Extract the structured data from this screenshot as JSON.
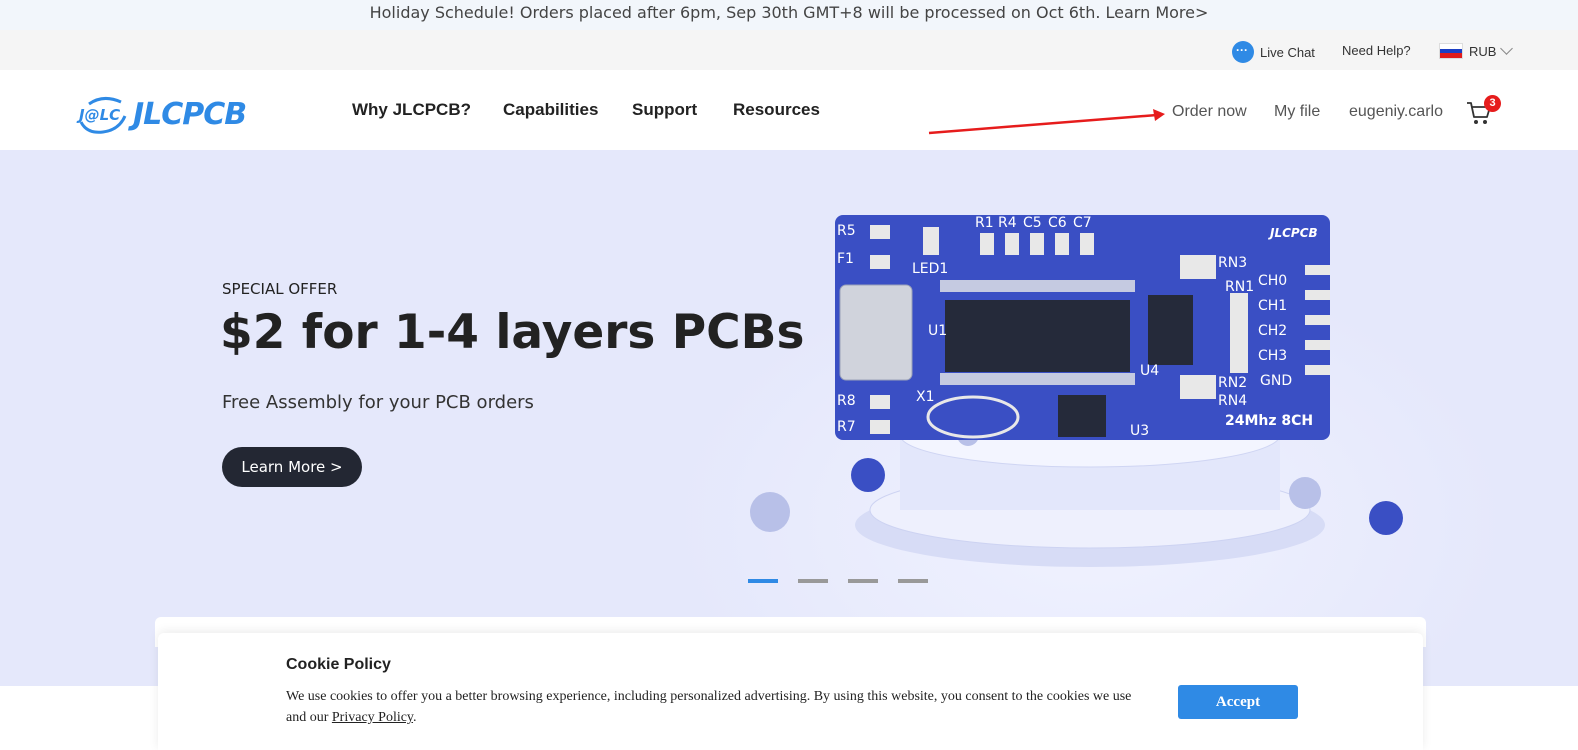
{
  "announcement": {
    "text": "Holiday Schedule! Orders placed after 6pm, Sep 30th GMT+8 will be processed on Oct 6th. Learn More>"
  },
  "topbar": {
    "live_chat": "Live Chat",
    "need_help": "Need Help?",
    "currency": "RUB"
  },
  "header": {
    "logo_mark": "J@LC",
    "logo_text": "JLCPCB",
    "nav": [
      "Why JLCPCB?",
      "Capabilities",
      "Support",
      "Resources"
    ],
    "order_now": "Order now",
    "my_file": "My file",
    "username": "eugeniy.carlo",
    "cart_count": "3"
  },
  "hero": {
    "kicker": "SPECIAL OFFER",
    "headline": "$2 for 1-4 layers PCBs",
    "subline": "Free Assembly for your PCB orders",
    "button": "Learn More >",
    "slide_count": 4,
    "active_slide": 1,
    "pcb": {
      "brand": "JLCPCB",
      "labels": [
        "R1",
        "R4",
        "C5",
        "C6",
        "C7",
        "R5",
        "F1",
        "LED1",
        "U1",
        "R8",
        "R7",
        "X1",
        "U3",
        "U4",
        "RN3",
        "RN1",
        "RN2",
        "RN4",
        "CH0",
        "CH1",
        "CH2",
        "CH3",
        "GND",
        "24Mhz 8CH"
      ]
    }
  },
  "cookie": {
    "title": "Cookie Policy",
    "text": "We use cookies to offer you a better browsing experience, including personalized advertising. By using this website, you consent to the cookies we use and our ",
    "link": "Privacy Policy",
    "end": ".",
    "accept": "Accept"
  },
  "colors": {
    "brand_blue": "#2f8ae5",
    "hero_bg": "#e5e8fb",
    "pcb_blue": "#3a4fc4",
    "button_dark": "#232733",
    "badge_red": "#e61c1c"
  }
}
